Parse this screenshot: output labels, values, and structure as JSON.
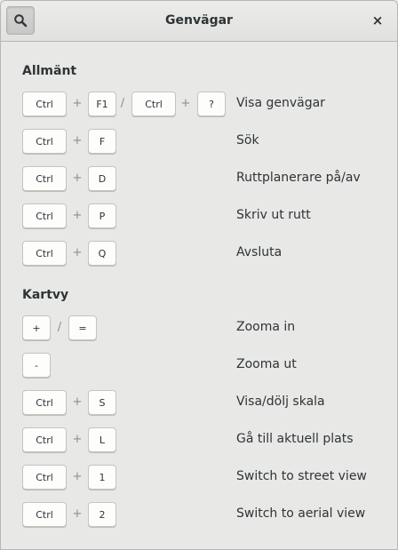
{
  "header": {
    "title": "Genvägar",
    "search_icon": "search-icon",
    "close_icon": "close-icon",
    "close_glyph": "×"
  },
  "sections": [
    {
      "title": "Allmänt",
      "shortcuts": [
        {
          "keys": [
            "Ctrl",
            "+",
            "F1",
            "/",
            "Ctrl",
            "+",
            "?"
          ],
          "description": "Visa genvägar"
        },
        {
          "keys": [
            "Ctrl",
            "+",
            "F"
          ],
          "description": "Sök"
        },
        {
          "keys": [
            "Ctrl",
            "+",
            "D"
          ],
          "description": "Ruttplanerare på/av"
        },
        {
          "keys": [
            "Ctrl",
            "+",
            "P"
          ],
          "description": "Skriv ut rutt"
        },
        {
          "keys": [
            "Ctrl",
            "+",
            "Q"
          ],
          "description": "Avsluta"
        }
      ]
    },
    {
      "title": "Kartvy",
      "shortcuts": [
        {
          "keys": [
            "+",
            "/",
            "="
          ],
          "description": "Zooma in"
        },
        {
          "keys": [
            "-"
          ],
          "description": "Zooma ut"
        },
        {
          "keys": [
            "Ctrl",
            "+",
            "S"
          ],
          "description": "Visa/dölj skala"
        },
        {
          "keys": [
            "Ctrl",
            "+",
            "L"
          ],
          "description": "Gå till aktuell plats"
        },
        {
          "keys": [
            "Ctrl",
            "+",
            "1"
          ],
          "description": "Switch to street view"
        },
        {
          "keys": [
            "Ctrl",
            "+",
            "2"
          ],
          "description": "Switch to aerial view"
        }
      ]
    }
  ]
}
